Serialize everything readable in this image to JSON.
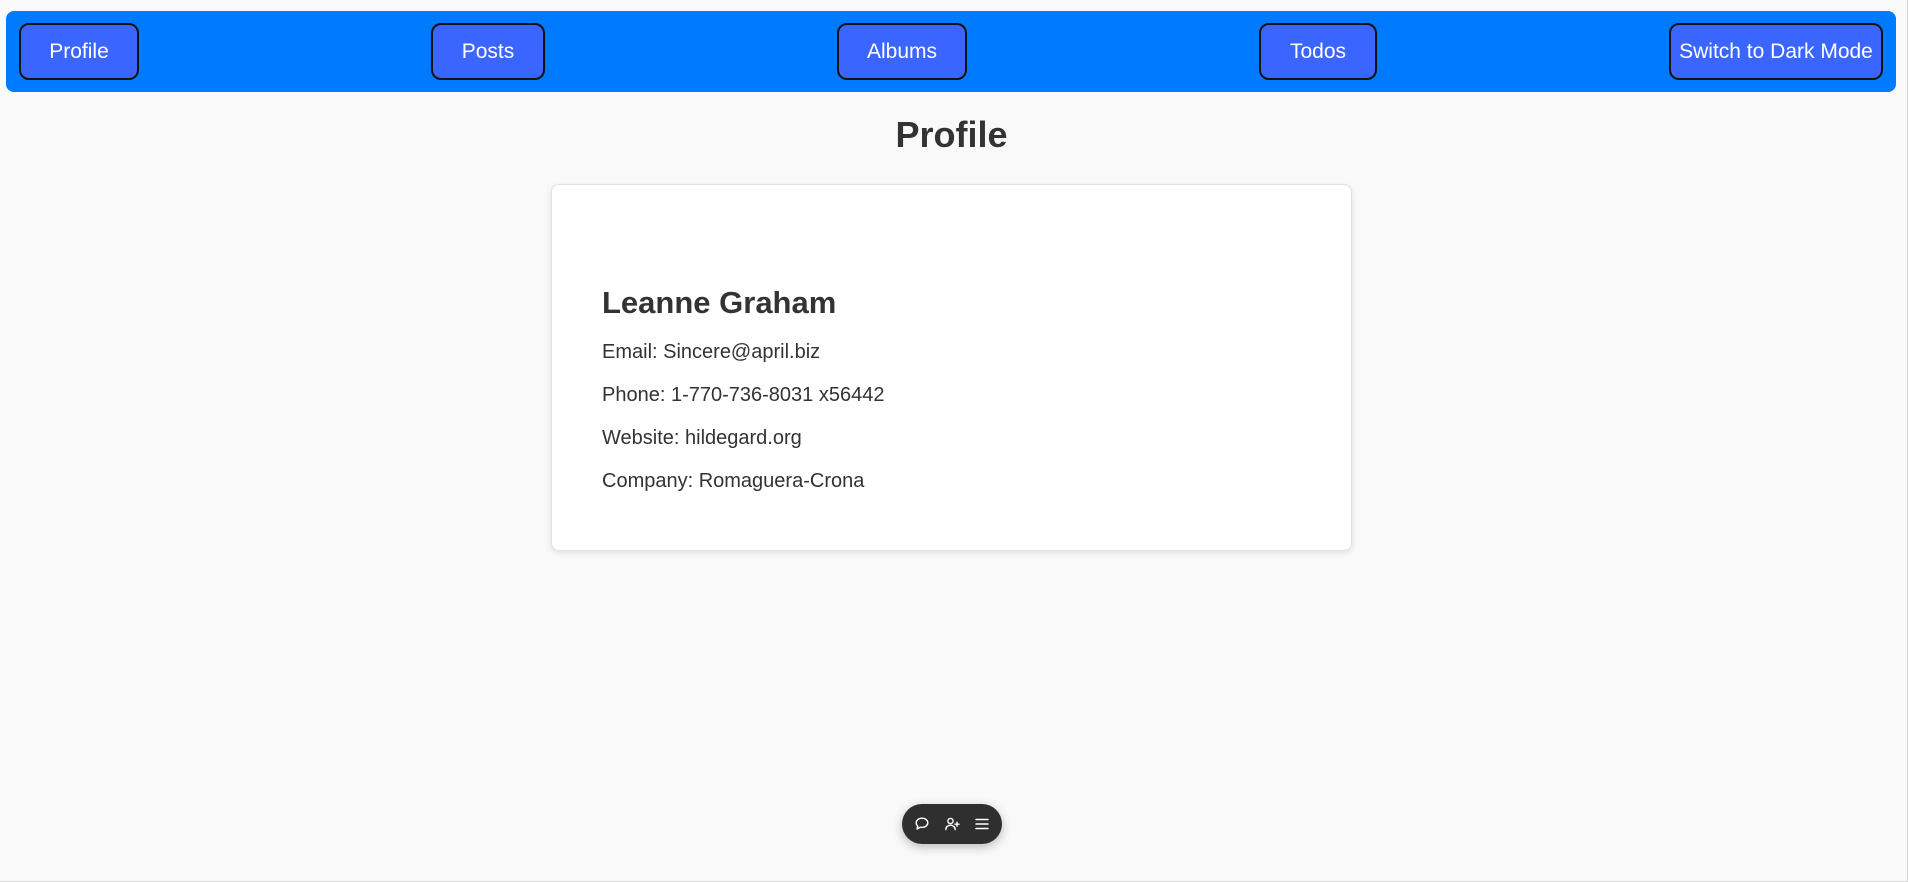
{
  "nav": {
    "profile_label": "Profile",
    "posts_label": "Posts",
    "albums_label": "Albums",
    "todos_label": "Todos",
    "theme_toggle_label": "Switch to Dark Mode"
  },
  "page": {
    "title": "Profile"
  },
  "profile": {
    "name": "Leanne Graham",
    "email": "Email: Sincere@april.biz",
    "phone": "Phone: 1-770-736-8031 x56442",
    "website": "Website: hildegard.org",
    "company": "Company: Romaguera-Crona"
  },
  "toolbar": {
    "icons": [
      "comment-icon",
      "add-user-icon",
      "menu-icon"
    ]
  },
  "colors": {
    "navbar": "#007bff",
    "nav_button": "#3a66ff",
    "background": "#f9f9f9",
    "text": "#333333",
    "toolbar": "#2f2f2f"
  }
}
